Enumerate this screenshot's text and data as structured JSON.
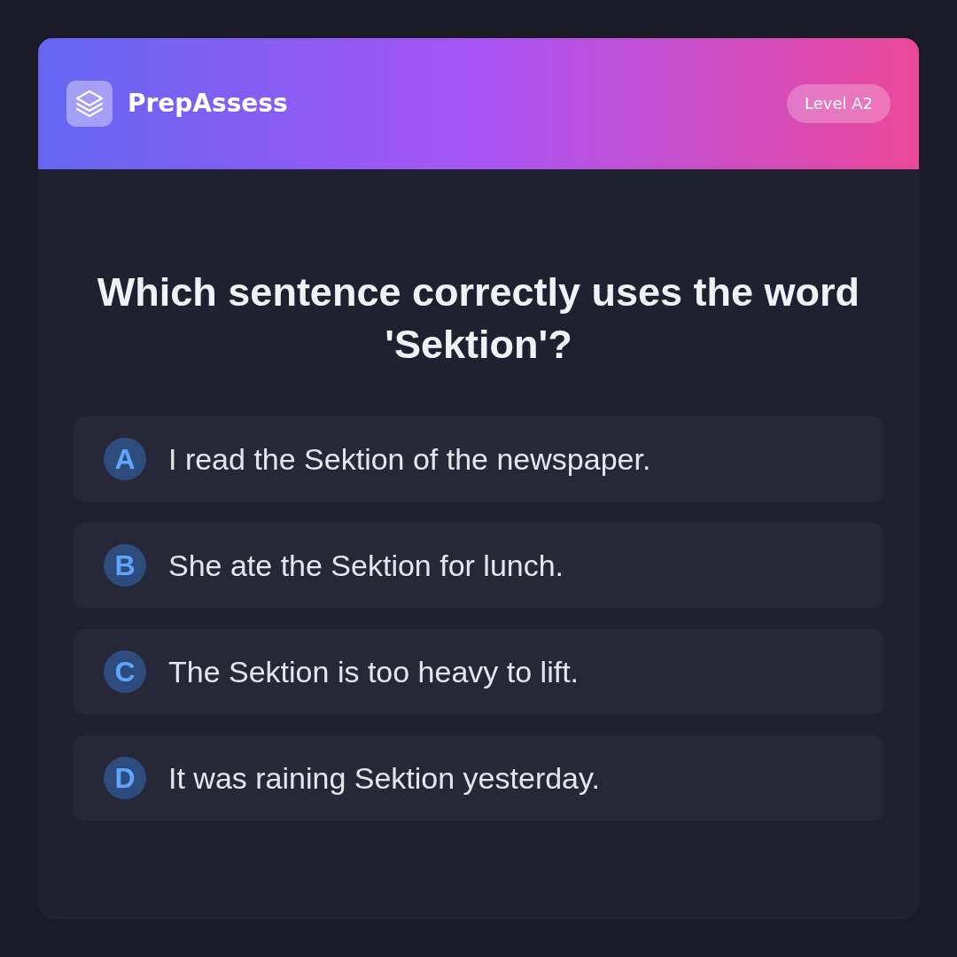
{
  "header": {
    "brand": "PrepAssess",
    "level_badge": "Level A2"
  },
  "question": "Which sentence correctly uses the word 'Sektion'?",
  "options": [
    {
      "letter": "A",
      "text": "I read the Sektion of the newspaper.",
      "selected": false
    },
    {
      "letter": "B",
      "text": "She ate the Sektion for lunch.",
      "selected": false
    },
    {
      "letter": "C",
      "text": "The Sektion is too heavy to lift.",
      "selected": false
    },
    {
      "letter": "D",
      "text": "It was raining Sektion yesterday.",
      "selected": false
    }
  ]
}
